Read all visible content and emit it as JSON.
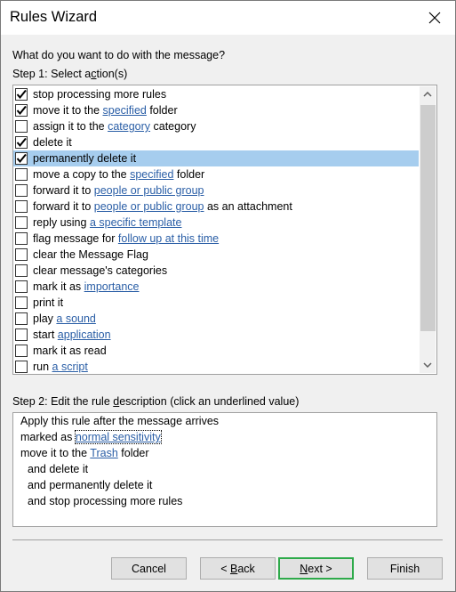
{
  "window": {
    "title": "Rules Wizard"
  },
  "prompt": "What do you want to do with the message?",
  "step1": {
    "pre": "Step 1: Select a",
    "mnemonic": "c",
    "post": "tion(s)"
  },
  "actions": [
    {
      "checked": true,
      "selected": false,
      "parts": [
        {
          "t": "stop processing more rules"
        }
      ]
    },
    {
      "checked": true,
      "selected": false,
      "parts": [
        {
          "t": "move it to the "
        },
        {
          "t": "specified",
          "link": true
        },
        {
          "t": " folder"
        }
      ]
    },
    {
      "checked": false,
      "selected": false,
      "parts": [
        {
          "t": "assign it to the "
        },
        {
          "t": "category",
          "link": true
        },
        {
          "t": " category"
        }
      ]
    },
    {
      "checked": true,
      "selected": false,
      "parts": [
        {
          "t": "delete it"
        }
      ]
    },
    {
      "checked": true,
      "selected": true,
      "parts": [
        {
          "t": "permanently delete it"
        }
      ]
    },
    {
      "checked": false,
      "selected": false,
      "parts": [
        {
          "t": "move a copy to the "
        },
        {
          "t": "specified",
          "link": true
        },
        {
          "t": " folder"
        }
      ]
    },
    {
      "checked": false,
      "selected": false,
      "parts": [
        {
          "t": "forward it to "
        },
        {
          "t": "people or public group",
          "link": true
        }
      ]
    },
    {
      "checked": false,
      "selected": false,
      "parts": [
        {
          "t": "forward it to "
        },
        {
          "t": "people or public group",
          "link": true
        },
        {
          "t": " as an attachment"
        }
      ]
    },
    {
      "checked": false,
      "selected": false,
      "parts": [
        {
          "t": "reply using "
        },
        {
          "t": "a specific template",
          "link": true
        }
      ]
    },
    {
      "checked": false,
      "selected": false,
      "parts": [
        {
          "t": "flag message for "
        },
        {
          "t": "follow up at this time",
          "link": true
        }
      ]
    },
    {
      "checked": false,
      "selected": false,
      "parts": [
        {
          "t": "clear the Message Flag"
        }
      ]
    },
    {
      "checked": false,
      "selected": false,
      "parts": [
        {
          "t": "clear message's categories"
        }
      ]
    },
    {
      "checked": false,
      "selected": false,
      "parts": [
        {
          "t": "mark it as "
        },
        {
          "t": "importance",
          "link": true
        }
      ]
    },
    {
      "checked": false,
      "selected": false,
      "parts": [
        {
          "t": "print it"
        }
      ]
    },
    {
      "checked": false,
      "selected": false,
      "parts": [
        {
          "t": "play "
        },
        {
          "t": "a sound",
          "link": true
        }
      ]
    },
    {
      "checked": false,
      "selected": false,
      "parts": [
        {
          "t": "start "
        },
        {
          "t": "application",
          "link": true
        }
      ]
    },
    {
      "checked": false,
      "selected": false,
      "parts": [
        {
          "t": "mark it as read"
        }
      ]
    },
    {
      "checked": false,
      "selected": false,
      "parts": [
        {
          "t": "run "
        },
        {
          "t": "a script",
          "link": true
        }
      ]
    }
  ],
  "step2": {
    "pre": "Step 2: Edit the rule ",
    "mnemonic": "d",
    "post": "escription (click an underlined value)"
  },
  "description": [
    {
      "indent": false,
      "parts": [
        {
          "t": "Apply this rule after the message arrives"
        }
      ]
    },
    {
      "indent": false,
      "parts": [
        {
          "t": "marked as "
        },
        {
          "t": "normal sensitivity",
          "link": true,
          "focus": true
        }
      ]
    },
    {
      "indent": false,
      "parts": [
        {
          "t": "move it to the "
        },
        {
          "t": "Trash",
          "link": true
        },
        {
          "t": " folder"
        }
      ]
    },
    {
      "indent": true,
      "parts": [
        {
          "t": "and delete it"
        }
      ]
    },
    {
      "indent": true,
      "parts": [
        {
          "t": "and permanently delete it"
        }
      ]
    },
    {
      "indent": true,
      "parts": [
        {
          "t": "and stop processing more rules"
        }
      ]
    }
  ],
  "buttons": {
    "cancel": "Cancel",
    "back_pre": "< ",
    "back_mn": "B",
    "back_post": "ack",
    "next_mn": "N",
    "next_post": "ext >",
    "finish": "Finish"
  },
  "colors": {
    "link": "#2a5ea6",
    "selection": "#a6cdee",
    "default_button_border": "#2eaa4a"
  }
}
